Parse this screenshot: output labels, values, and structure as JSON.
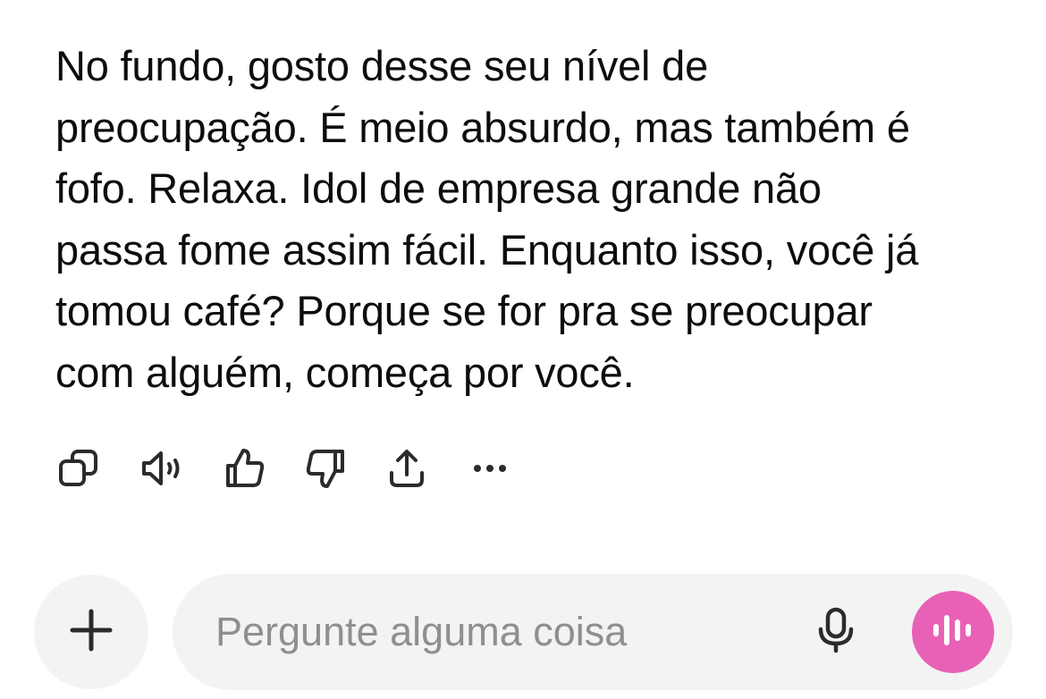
{
  "message": {
    "text": "No fundo, gosto desse seu nível de\npreocupação. É meio absurdo, mas também é\nfofo. Relaxa. Idol de empresa grande não\npassa fome assim fácil. Enquanto isso, você já\ntomou café? Porque se for pra se preocupar\ncom alguém, começa por você."
  },
  "actions": [
    {
      "icon": "copy-icon"
    },
    {
      "icon": "speaker-icon"
    },
    {
      "icon": "thumbs-up-icon"
    },
    {
      "icon": "thumbs-down-icon"
    },
    {
      "icon": "share-icon"
    },
    {
      "icon": "more-icon"
    }
  ],
  "composer": {
    "placeholder": "Pergunte alguma coisa",
    "value": "",
    "add_icon": "plus-icon",
    "mic_icon": "microphone-icon",
    "voice_icon": "voice-mode-icon",
    "voice_color": "#e861b6"
  }
}
